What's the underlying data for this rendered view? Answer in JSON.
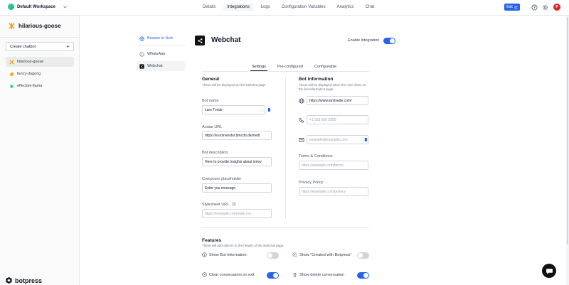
{
  "topbar": {
    "workspace": "Default Workspace",
    "tabs": [
      "Details",
      "Integrations",
      "Logs",
      "Configuration Variables",
      "Analytics",
      "Chat"
    ],
    "active_tab": "Integrations",
    "edit_label": "Edit",
    "avatar_initial": "P"
  },
  "sidebar": {
    "bot_name": "hilarious-goose",
    "create_label": "Create chatbot",
    "bots": [
      "hilarious-goose",
      "fancy-dugong",
      "effective-llama"
    ],
    "brand": "botpress"
  },
  "subnav": {
    "browse": "Browse in Hub",
    "items": [
      "WhatsApp",
      "Webchat"
    ]
  },
  "main": {
    "title": "Webchat",
    "enable_label": "Enable integration",
    "enabled": true,
    "tabs": [
      "Settings",
      "Pre-configured",
      "Configurable"
    ],
    "general": {
      "title": "General",
      "desc": "These will be displayed on the webchat page",
      "bot_name_label": "Bot name",
      "bot_name": "Lars Tvede",
      "avatar_label": "Avatar URL",
      "avatar": "https://euroinvestor.bmcdn.dk/medi",
      "desc_label": "Bot description",
      "description": "Here to provide insights about innov",
      "composer_label": "Composer placeholder",
      "composer": "Enter you message",
      "stylesheet_label": "Stylesheet URL",
      "stylesheet_ph": "https://example.com/style.css"
    },
    "botinfo": {
      "title": "Bot information",
      "desc": "These will be displayed when the user clicks on the bot information page",
      "website": "https://www.larstvede.com/",
      "phone_ph": "+1 555 555 5555",
      "email_ph": "example@example.com",
      "terms_label": "Terms & Conditions",
      "terms_ph": "https://example.com/terms",
      "privacy_label": "Privacy Policy",
      "privacy_ph": "https://example.com/privacy"
    },
    "features": {
      "title": "Features",
      "desc": "These will add options to the header of the webchat page.",
      "show_bot_info": "Show Bot Information",
      "show_created": "Show \"Created with Botpress\"",
      "clear_conv": "Clear conversation on exit",
      "show_delete": "Show delete conversation"
    }
  },
  "colors": {
    "accent": "#2563eb",
    "avatar": "#dc2626"
  }
}
